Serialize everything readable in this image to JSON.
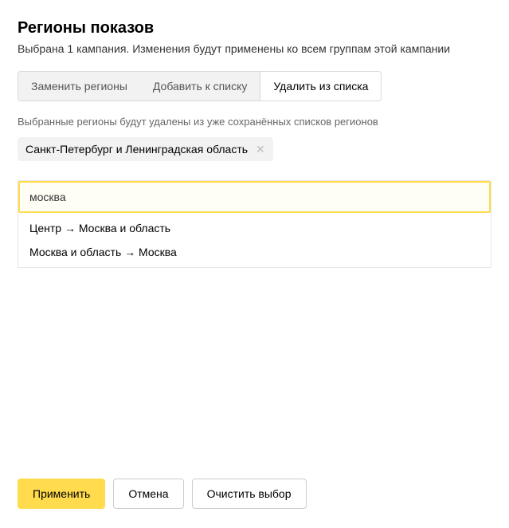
{
  "header": {
    "title": "Регионы показов",
    "subtitle": "Выбрана 1 кампания. Изменения будут применены ко всем группам этой кампании"
  },
  "tabs": {
    "replace": "Заменить регионы",
    "add": "Добавить к списку",
    "remove": "Удалить из списка"
  },
  "hint": "Выбранные регионы будут удалены из уже сохранённых списков регионов",
  "chips": [
    {
      "label": "Санкт-Петербург и Ленинградская область"
    }
  ],
  "search": {
    "value": "москва",
    "suggestions": [
      "Центр → Москва и область",
      "Москва и область → Москва"
    ]
  },
  "footer": {
    "apply": "Применить",
    "cancel": "Отмена",
    "clear": "Очистить выбор"
  }
}
